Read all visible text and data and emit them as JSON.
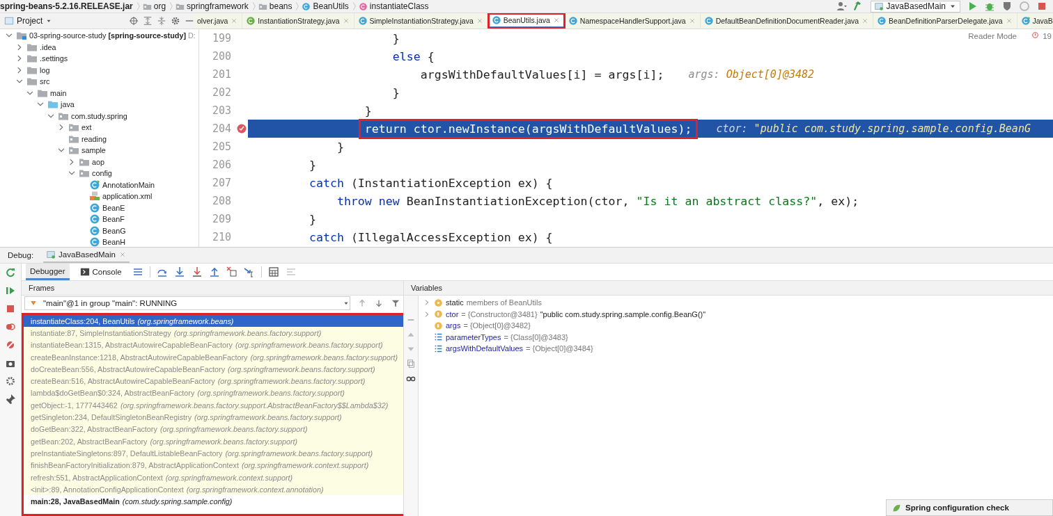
{
  "breadcrumbs": [
    {
      "kind": "jar",
      "label": "spring-beans-5.2.16.RELEASE.jar"
    },
    {
      "kind": "package",
      "label": "org"
    },
    {
      "kind": "package",
      "label": "springframework"
    },
    {
      "kind": "package",
      "label": "beans"
    },
    {
      "kind": "class",
      "label": "BeanUtils"
    },
    {
      "kind": "method",
      "label": "instantiateClass"
    }
  ],
  "run_config": {
    "label": "JavaBasedMain"
  },
  "project": {
    "title": "Project",
    "tree": [
      {
        "kind": "module",
        "label": "03-spring-source-study **[spring-source-study]**",
        "path": "D:",
        "expanded": true,
        "children": [
          {
            "kind": "folder",
            "label": ".idea",
            "expanded": false
          },
          {
            "kind": "folder",
            "label": ".settings",
            "expanded": false
          },
          {
            "kind": "folder",
            "label": "log",
            "expanded": false
          },
          {
            "kind": "folder",
            "label": "src",
            "expanded": true,
            "children": [
              {
                "kind": "folder",
                "label": "main",
                "expanded": true,
                "children": [
                  {
                    "kind": "source-folder",
                    "label": "java",
                    "expanded": true,
                    "children": [
                      {
                        "kind": "package",
                        "label": "com.study.spring",
                        "expanded": true,
                        "children": [
                          {
                            "kind": "package",
                            "label": "ext",
                            "expanded": false
                          },
                          {
                            "kind": "package",
                            "label": "reading"
                          },
                          {
                            "kind": "package",
                            "label": "sample",
                            "expanded": true,
                            "children": [
                              {
                                "kind": "package",
                                "label": "aop",
                                "expanded": false
                              },
                              {
                                "kind": "package",
                                "label": "config",
                                "expanded": true,
                                "children": [
                                  {
                                    "kind": "main-class",
                                    "label": "AnnotationMain"
                                  },
                                  {
                                    "kind": "xml",
                                    "label": "application.xml"
                                  },
                                  {
                                    "kind": "class",
                                    "label": "BeanE"
                                  },
                                  {
                                    "kind": "class",
                                    "label": "BeanF"
                                  },
                                  {
                                    "kind": "class",
                                    "label": "BeanG"
                                  },
                                  {
                                    "kind": "class",
                                    "label": "BeanH"
                                  }
                                ]
                              }
                            ]
                          }
                        ]
                      }
                    ]
                  }
                ]
              }
            ]
          }
        ]
      }
    ]
  },
  "editor_tabs": [
    {
      "kind": "partial",
      "label": "olver.java",
      "selected": false,
      "annotated": false,
      "closable": true
    },
    {
      "kind": "interface",
      "label": "InstantiationStrategy.java",
      "selected": false,
      "annotated": false,
      "closable": true
    },
    {
      "kind": "class",
      "label": "SimpleInstantiationStrategy.java",
      "selected": false,
      "annotated": false,
      "closable": true
    },
    {
      "kind": "class",
      "label": "BeanUtils.java",
      "selected": true,
      "annotated": true,
      "closable": true
    },
    {
      "kind": "class",
      "label": "NamespaceHandlerSupport.java",
      "selected": false,
      "annotated": false,
      "closable": true
    },
    {
      "kind": "class",
      "label": "DefaultBeanDefinitionDocumentReader.java",
      "selected": false,
      "annotated": false,
      "closable": true
    },
    {
      "kind": "class",
      "label": "BeanDefinitionParserDelegate.java",
      "selected": false,
      "annotated": false,
      "closable": true
    },
    {
      "kind": "main-class",
      "label": "JavaB",
      "selected": false,
      "annotated": false,
      "closable": false
    }
  ],
  "editor": {
    "reader_mode": "Reader Mode",
    "problems": "19",
    "lines": [
      {
        "number": "199",
        "breakpoint": false,
        "current": false,
        "annotated": false,
        "tokens": [
          {
            "kind": "plain",
            "text": "                    }"
          }
        ]
      },
      {
        "number": "200",
        "breakpoint": false,
        "current": false,
        "annotated": false,
        "tokens": [
          {
            "kind": "keyword",
            "text": "                    else"
          },
          {
            "kind": "plain",
            "text": " {"
          }
        ]
      },
      {
        "number": "201",
        "breakpoint": false,
        "current": false,
        "annotated": false,
        "tokens": [
          {
            "kind": "plain",
            "text": "                        argsWithDefaultValues[i] = args[i];"
          }
        ],
        "hint": [
          {
            "kind": "name",
            "text": "args:"
          },
          {
            "kind": "value",
            "text": "Object[0]@3482"
          }
        ]
      },
      {
        "number": "202",
        "breakpoint": false,
        "current": false,
        "annotated": false,
        "tokens": [
          {
            "kind": "plain",
            "text": "                    }"
          }
        ]
      },
      {
        "number": "203",
        "breakpoint": false,
        "current": false,
        "annotated": false,
        "tokens": [
          {
            "kind": "plain",
            "text": "                }"
          }
        ]
      },
      {
        "number": "204",
        "breakpoint": true,
        "current": true,
        "annotated": true,
        "tokens": [
          {
            "kind": "keyword",
            "text": "                return"
          },
          {
            "kind": "plain",
            "text": " ctor.newInstance(argsWithDefaultValues);"
          }
        ],
        "hint": [
          {
            "kind": "name",
            "text": "ctor:"
          },
          {
            "kind": "string",
            "text": "\"public com.study.spring.sample.config.BeanG"
          }
        ]
      },
      {
        "number": "205",
        "breakpoint": false,
        "current": false,
        "annotated": false,
        "tokens": [
          {
            "kind": "plain",
            "text": "            }"
          }
        ]
      },
      {
        "number": "206",
        "breakpoint": false,
        "current": false,
        "annotated": false,
        "tokens": [
          {
            "kind": "plain",
            "text": "        }"
          }
        ]
      },
      {
        "number": "207",
        "breakpoint": false,
        "current": false,
        "annotated": false,
        "tokens": [
          {
            "kind": "keyword",
            "text": "        catch"
          },
          {
            "kind": "plain",
            "text": " (InstantiationException ex) {"
          }
        ]
      },
      {
        "number": "208",
        "breakpoint": false,
        "current": false,
        "annotated": false,
        "tokens": [
          {
            "kind": "keyword",
            "text": "            throw new"
          },
          {
            "kind": "plain",
            "text": " BeanInstantiationException(ctor, "
          },
          {
            "kind": "string",
            "text": "\"Is it an abstract class?\""
          },
          {
            "kind": "plain",
            "text": ", ex);"
          }
        ]
      },
      {
        "number": "209",
        "breakpoint": false,
        "current": false,
        "annotated": false,
        "tokens": [
          {
            "kind": "plain",
            "text": "        }"
          }
        ]
      },
      {
        "number": "210",
        "breakpoint": false,
        "current": false,
        "annotated": false,
        "tokens": [
          {
            "kind": "keyword",
            "text": "        catch"
          },
          {
            "kind": "plain",
            "text": " (IllegalAccessException ex) {"
          }
        ]
      }
    ]
  },
  "debug": {
    "label": "Debug:",
    "session_tab": {
      "label": "JavaBasedMain"
    },
    "tabs": [
      {
        "kind": "debugger",
        "label": "Debugger",
        "selected": true
      },
      {
        "kind": "console",
        "label": "Console",
        "selected": false
      }
    ],
    "frames": {
      "title": "Frames",
      "thread": "\"main\"@1 in group \"main\": RUNNING",
      "annotated": true,
      "items": [
        {
          "location": "instantiateClass:204, BeanUtils",
          "package": "(org.springframework.beans)",
          "library": true,
          "selected": true
        },
        {
          "location": "instantiate:87, SimpleInstantiationStrategy",
          "package": "(org.springframework.beans.factory.support)",
          "library": true,
          "selected": false
        },
        {
          "location": "instantiateBean:1315, AbstractAutowireCapableBeanFactory",
          "package": "(org.springframework.beans.factory.support)",
          "library": true,
          "selected": false
        },
        {
          "location": "createBeanInstance:1218, AbstractAutowireCapableBeanFactory",
          "package": "(org.springframework.beans.factory.support)",
          "library": true,
          "selected": false
        },
        {
          "location": "doCreateBean:556, AbstractAutowireCapableBeanFactory",
          "package": "(org.springframework.beans.factory.support)",
          "library": true,
          "selected": false
        },
        {
          "location": "createBean:516, AbstractAutowireCapableBeanFactory",
          "package": "(org.springframework.beans.factory.support)",
          "library": true,
          "selected": false
        },
        {
          "location": "lambda$doGetBean$0:324, AbstractBeanFactory",
          "package": "(org.springframework.beans.factory.support)",
          "library": true,
          "selected": false
        },
        {
          "location": "getObject:-1, 1777443462",
          "package": "(org.springframework.beans.factory.support.AbstractBeanFactory$$Lambda$32)",
          "library": true,
          "selected": false
        },
        {
          "location": "getSingleton:234, DefaultSingletonBeanRegistry",
          "package": "(org.springframework.beans.factory.support)",
          "library": true,
          "selected": false
        },
        {
          "location": "doGetBean:322, AbstractBeanFactory",
          "package": "(org.springframework.beans.factory.support)",
          "library": true,
          "selected": false
        },
        {
          "location": "getBean:202, AbstractBeanFactory",
          "package": "(org.springframework.beans.factory.support)",
          "library": true,
          "selected": false
        },
        {
          "location": "preInstantiateSingletons:897, DefaultListableBeanFactory",
          "package": "(org.springframework.beans.factory.support)",
          "library": true,
          "selected": false
        },
        {
          "location": "finishBeanFactoryInitialization:879, AbstractApplicationContext",
          "package": "(org.springframework.context.support)",
          "library": true,
          "selected": false
        },
        {
          "location": "refresh:551, AbstractApplicationContext",
          "package": "(org.springframework.context.support)",
          "library": true,
          "selected": false
        },
        {
          "location": "<init>:89, AnnotationConfigApplicationContext",
          "package": "(org.springframework.context.annotation)",
          "library": true,
          "selected": false
        },
        {
          "location": "main:28, JavaBasedMain",
          "package": "(com.study.spring.sample.config)",
          "library": false,
          "selected": false
        }
      ]
    },
    "variables": {
      "title": "Variables",
      "items": [
        {
          "kind": "static",
          "expandable": true,
          "name": "static",
          "value": "members of BeanUtils"
        },
        {
          "kind": "field",
          "expandable": true,
          "name": "ctor",
          "value": "= {Constructor@3481}",
          "string": "\"public com.study.spring.sample.config.BeanG()\""
        },
        {
          "kind": "field",
          "expandable": false,
          "name": "args",
          "value": "= {Object[0]@3482}"
        },
        {
          "kind": "array",
          "expandable": false,
          "name": "parameterTypes",
          "value": "= {Class[0]@3483}"
        },
        {
          "kind": "array",
          "expandable": false,
          "name": "argsWithDefaultValues",
          "value": "= {Object[0]@3484}"
        }
      ]
    }
  },
  "notification": {
    "label": "Spring configuration check"
  }
}
